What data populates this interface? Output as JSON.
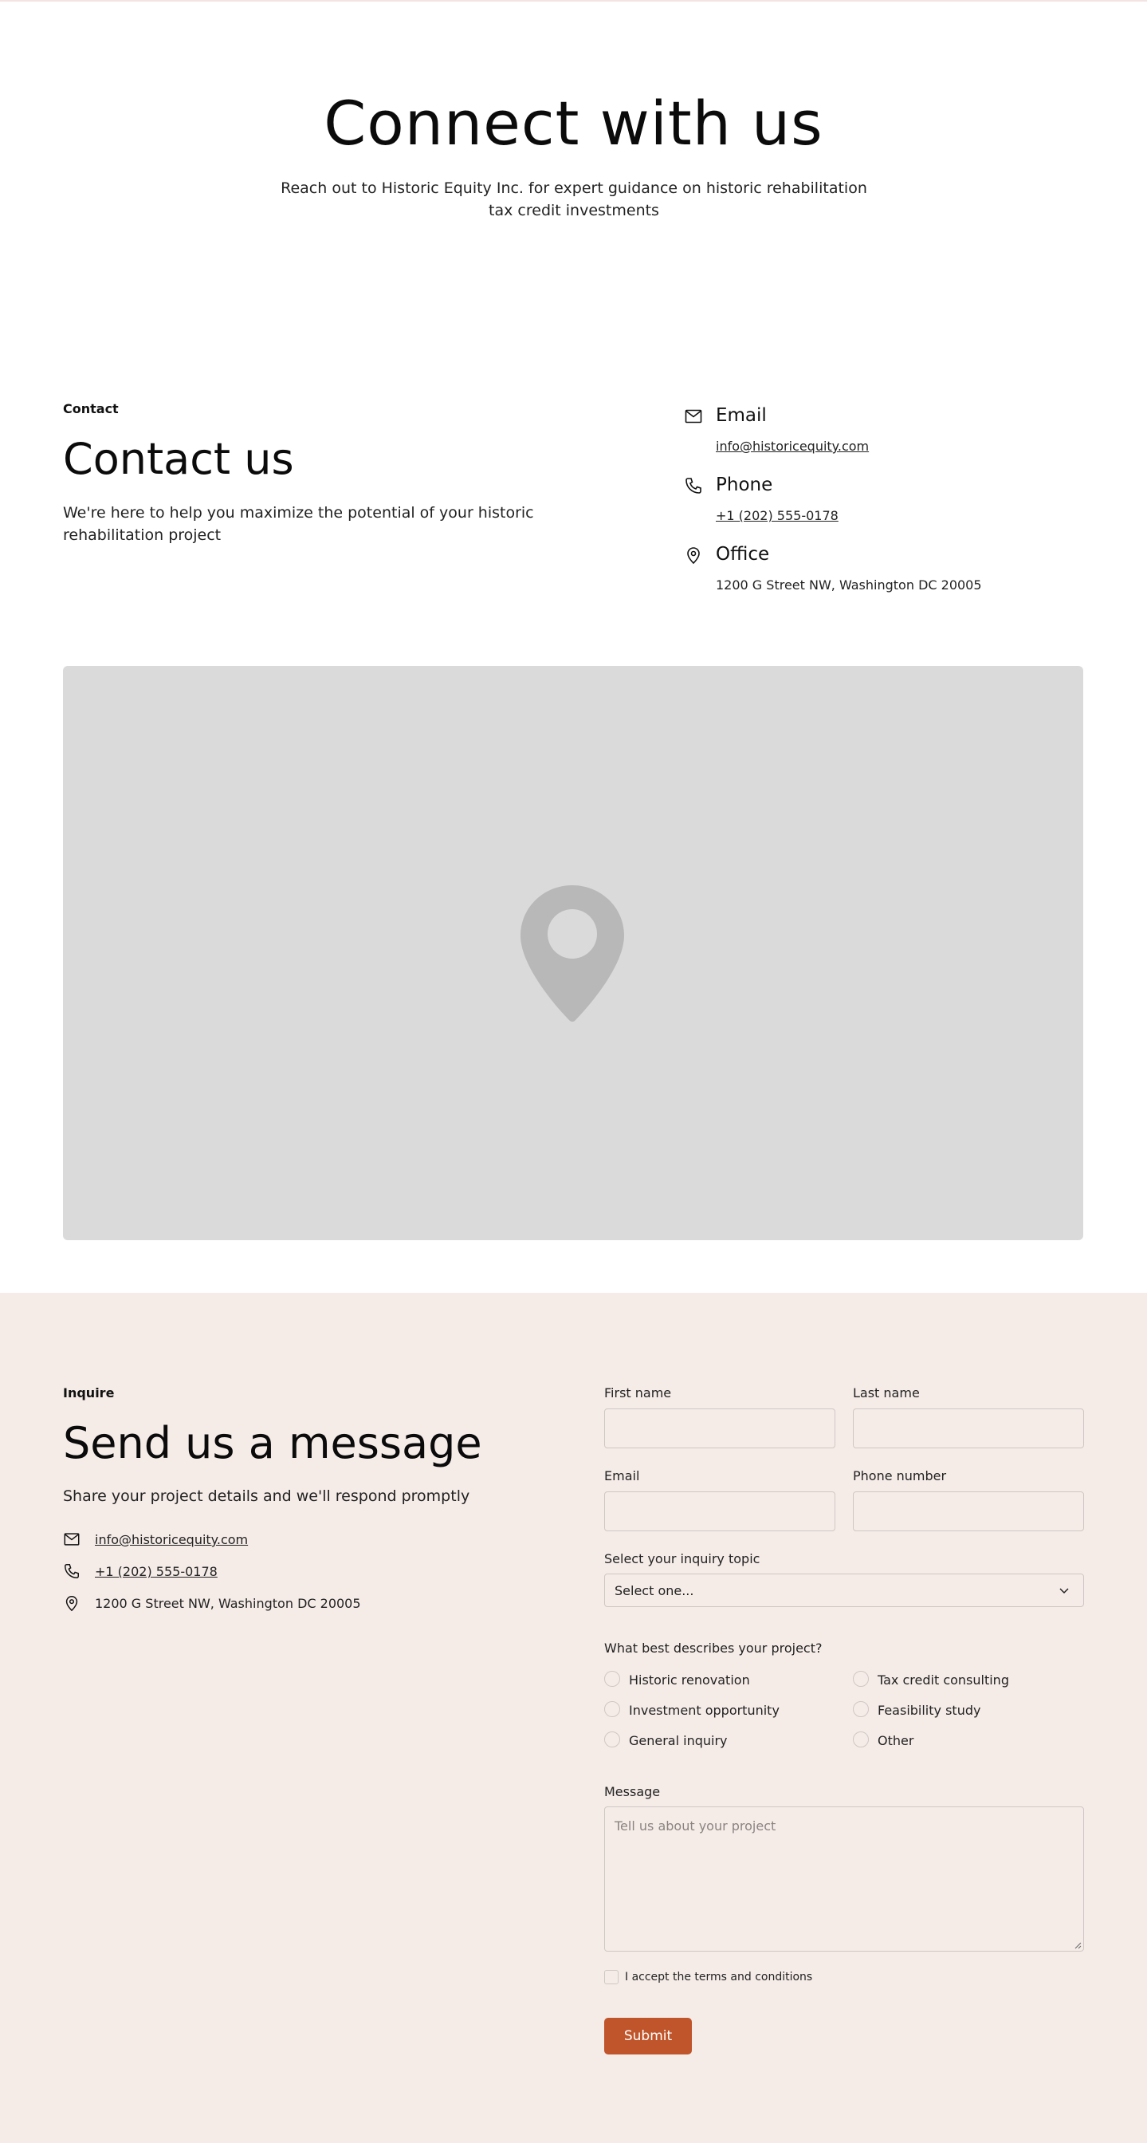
{
  "hero": {
    "title": "Connect with us",
    "subtitle": "Reach out to Historic Equity Inc. for expert guidance on historic rehabilitation tax credit investments"
  },
  "contact": {
    "eyebrow": "Contact",
    "heading": "Contact us",
    "description": "We're here to help you maximize the potential of your historic rehabilitation project",
    "items": [
      {
        "icon": "mail-icon",
        "title": "Email",
        "value": "info@historicequity.com"
      },
      {
        "icon": "phone-icon",
        "title": "Phone",
        "value": "+1 (202) 555-0178"
      },
      {
        "icon": "map-pin-icon",
        "title": "Office",
        "value": "1200 G Street NW, Washington DC 20005"
      }
    ]
  },
  "map": {
    "icon": "map-pin-icon"
  },
  "inquire": {
    "eyebrow": "Inquire",
    "heading": "Send us a message",
    "subtitle": "Share your project details and we'll respond promptly",
    "email": "info@historicequity.com",
    "phone": "+1 (202) 555-0178",
    "address": "1200 G Street NW, Washington DC 20005"
  },
  "form": {
    "first_name_label": "First name",
    "last_name_label": "Last name",
    "email_label": "Email",
    "phone_label": "Phone number",
    "topic_label": "Select your inquiry topic",
    "topic_value": "Select one...",
    "project_question": "What best describes your project?",
    "options": [
      "Historic renovation",
      "Tax credit consulting",
      "Investment opportunity",
      "Feasibility study",
      "General inquiry",
      "Other"
    ],
    "message_label": "Message",
    "message_placeholder": "Tell us about your project",
    "terms_label": "I accept the terms and conditions",
    "submit_label": "Submit"
  },
  "colors": {
    "accent": "#c0552b",
    "section_bg": "#f5ece8",
    "map_bg": "#dadada"
  }
}
